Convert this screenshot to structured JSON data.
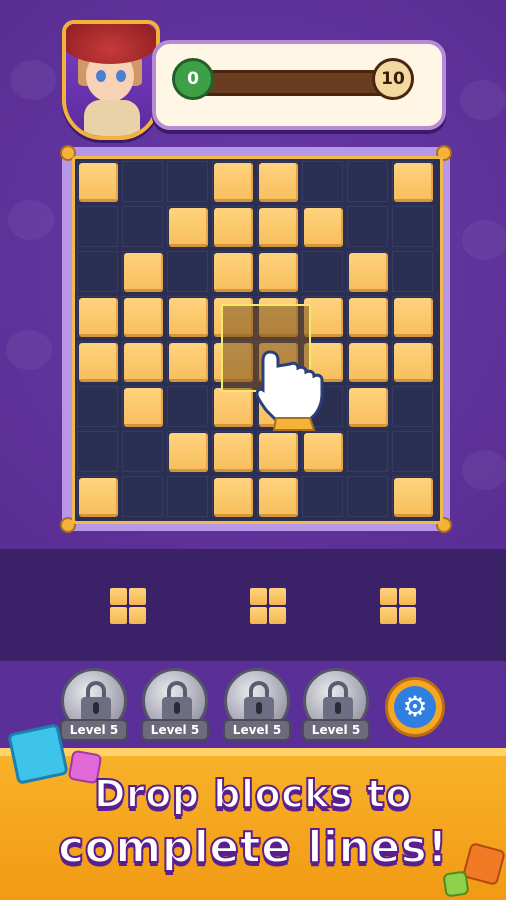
{
  "progress": {
    "current": "0",
    "target": "10",
    "fraction": 0
  },
  "board": {
    "rows": 8,
    "cols": 8,
    "filled": [
      [
        1,
        0,
        0,
        1,
        1,
        0,
        0,
        1
      ],
      [
        0,
        0,
        1,
        1,
        1,
        1,
        0,
        0
      ],
      [
        0,
        1,
        0,
        1,
        1,
        0,
        1,
        0
      ],
      [
        1,
        1,
        1,
        2,
        2,
        1,
        1,
        1
      ],
      [
        1,
        1,
        1,
        2,
        2,
        1,
        1,
        1
      ],
      [
        0,
        1,
        0,
        1,
        1,
        0,
        1,
        0
      ],
      [
        0,
        0,
        1,
        1,
        1,
        1,
        0,
        0
      ],
      [
        1,
        0,
        0,
        1,
        1,
        0,
        0,
        1
      ]
    ]
  },
  "tray": {
    "pieces": [
      "2x2-square",
      "2x2-square",
      "2x2-square"
    ]
  },
  "levels": [
    {
      "label": "Level 5",
      "icon": "lock-icon"
    },
    {
      "label": "Level 5",
      "icon": "lock-icon"
    },
    {
      "label": "Level 5",
      "icon": "lock-icon"
    },
    {
      "label": "Level 5",
      "icon": "lock-icon"
    }
  ],
  "settings_icon": "gear-icon",
  "promo": {
    "line1": "Drop blocks to",
    "line2": "complete lines!"
  },
  "colors": {
    "block": "#f8bf5e",
    "board": "#2b2f52",
    "accent": "#f3b33a",
    "promo_bg": "#f5a623",
    "text_outline": "#5b1e8f"
  }
}
